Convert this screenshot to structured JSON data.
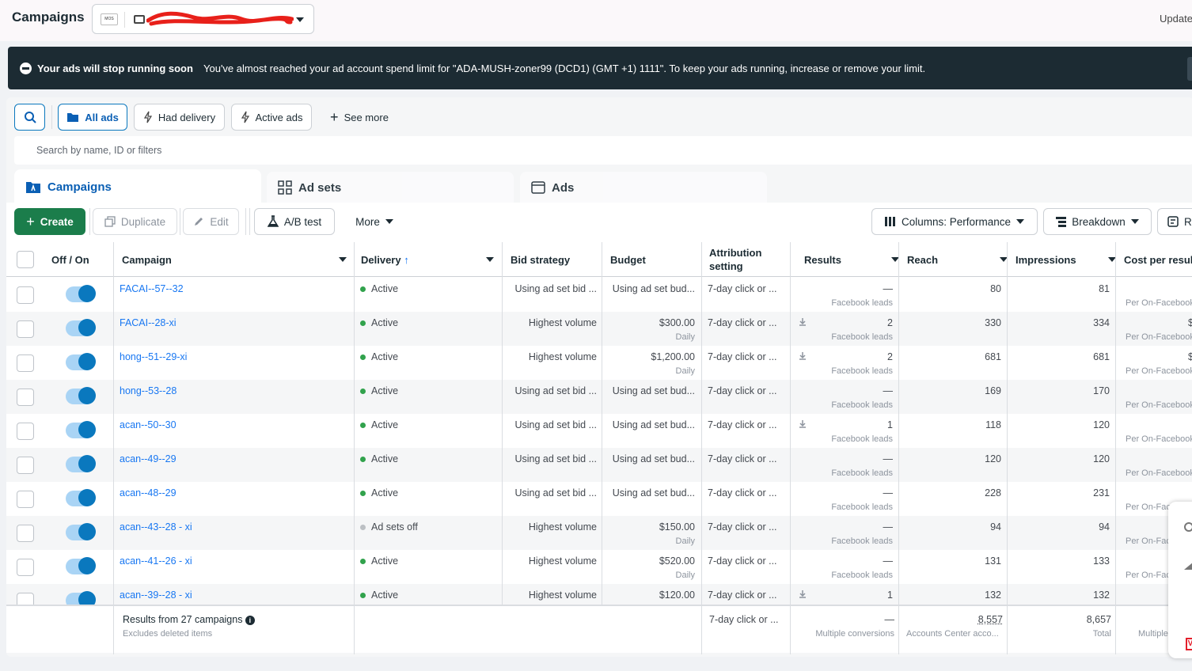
{
  "header": {
    "title": "Campaigns",
    "updated_label": "Updated",
    "account_logo_text": "MOS"
  },
  "banner": {
    "heading": "Your ads will stop running soon",
    "message": "You've almost reached your ad account spend limit for \"ADA-MUSH-zoner99 (DCD1) (GMT +1) 1111\". To keep your ads running, increase or remove your limit."
  },
  "filters": {
    "all_ads": "All ads",
    "had_delivery": "Had delivery",
    "active_ads": "Active ads",
    "see_more": "See more",
    "search_placeholder": "Search by name, ID or filters"
  },
  "tabs": {
    "campaigns": "Campaigns",
    "ad_sets": "Ad sets",
    "ads": "Ads"
  },
  "toolbar": {
    "create": "Create",
    "duplicate": "Duplicate",
    "edit": "Edit",
    "ab_test": "A/B test",
    "more": "More",
    "columns": "Columns: Performance",
    "breakdown": "Breakdown",
    "reports": "R"
  },
  "columns": {
    "off_on": "Off / On",
    "campaign": "Campaign",
    "delivery": "Delivery",
    "bid_strategy": "Bid strategy",
    "budget": "Budget",
    "attribution_line1": "Attribution",
    "attribution_line2": "setting",
    "results": "Results",
    "reach": "Reach",
    "impressions": "Impressions",
    "cost_per_result": "Cost per resul"
  },
  "rows": [
    {
      "name": "FACAI--57--32",
      "delivery": "Active",
      "bid": "Using ad set bid ...",
      "budget": "Using ad set bud...",
      "budget_sub": "",
      "attribution": "7-day click or ...",
      "results": "—",
      "results_sub": "Facebook leads",
      "reach": "80",
      "impressions": "81",
      "cost": "",
      "cost_sub": "Per On-Facebook"
    },
    {
      "name": "FACAI--28-xi",
      "delivery": "Active",
      "bid": "Highest volume",
      "budget": "$300.00",
      "budget_sub": "Daily",
      "attribution": "7-day click or ...",
      "results": "2",
      "results_sub": "Facebook leads",
      "reach": "330",
      "impressions": "334",
      "cost": "$",
      "cost_sub": "Per On-Facebook"
    },
    {
      "name": "hong--51--29-xi",
      "delivery": "Active",
      "bid": "Highest volume",
      "budget": "$1,200.00",
      "budget_sub": "Daily",
      "attribution": "7-day click or ...",
      "results": "2",
      "results_sub": "Facebook leads",
      "reach": "681",
      "impressions": "681",
      "cost": "$",
      "cost_sub": "Per On-Facebook"
    },
    {
      "name": "hong--53--28",
      "delivery": "Active",
      "bid": "Using ad set bid ...",
      "budget": "Using ad set bud...",
      "budget_sub": "",
      "attribution": "7-day click or ...",
      "results": "—",
      "results_sub": "Facebook leads",
      "reach": "169",
      "impressions": "170",
      "cost": "",
      "cost_sub": "Per On-Facebook"
    },
    {
      "name": "acan--50--30",
      "delivery": "Active",
      "bid": "Using ad set bid ...",
      "budget": "Using ad set bud...",
      "budget_sub": "",
      "attribution": "7-day click or ...",
      "results": "1",
      "results_sub": "Facebook leads",
      "reach": "118",
      "impressions": "120",
      "cost": "",
      "cost_sub": "Per On-Facebook"
    },
    {
      "name": "acan--49--29",
      "delivery": "Active",
      "bid": "Using ad set bid ...",
      "budget": "Using ad set bud...",
      "budget_sub": "",
      "attribution": "7-day click or ...",
      "results": "—",
      "results_sub": "Facebook leads",
      "reach": "120",
      "impressions": "120",
      "cost": "",
      "cost_sub": "Per On-Facebook"
    },
    {
      "name": "acan--48--29",
      "delivery": "Active",
      "bid": "Using ad set bid ...",
      "budget": "Using ad set bud...",
      "budget_sub": "",
      "attribution": "7-day click or ...",
      "results": "—",
      "results_sub": "Facebook leads",
      "reach": "228",
      "impressions": "231",
      "cost": "",
      "cost_sub": "Per On-Fac"
    },
    {
      "name": "acan--43--28 - xi",
      "delivery": "Ad sets off",
      "bid": "Highest volume",
      "budget": "$150.00",
      "budget_sub": "Daily",
      "attribution": "7-day click or ...",
      "results": "—",
      "results_sub": "Facebook leads",
      "reach": "94",
      "impressions": "94",
      "cost": "",
      "cost_sub": "Per On-Fac"
    },
    {
      "name": "acan--41--26 - xi",
      "delivery": "Active",
      "bid": "Highest volume",
      "budget": "$520.00",
      "budget_sub": "Daily",
      "attribution": "7-day click or ...",
      "results": "—",
      "results_sub": "Facebook leads",
      "reach": "131",
      "impressions": "133",
      "cost": "",
      "cost_sub": "Per On-Fac"
    },
    {
      "name": "acan--39--28 - xi",
      "delivery": "Active",
      "bid": "Highest volume",
      "budget": "$120.00",
      "budget_sub": "",
      "attribution": "7-day click or ...",
      "results": "1",
      "results_sub": "",
      "reach": "132",
      "impressions": "132",
      "cost": "",
      "cost_sub": ""
    }
  ],
  "footer": {
    "results_label": "Results from 27 campaigns",
    "excludes": "Excludes deleted items",
    "attribution": "7-day click or ...",
    "results": "—",
    "results_sub": "Multiple conversions",
    "reach": "8,557",
    "reach_sub": "Accounts Center acco...",
    "impressions": "8,657",
    "impressions_sub": "Total",
    "cost_sub": "Multiple"
  },
  "colors": {
    "active_dot": "#31a24c",
    "off_dot": "#bcc0c4",
    "link": "#1877f2",
    "create_green": "#1b7d4b"
  }
}
